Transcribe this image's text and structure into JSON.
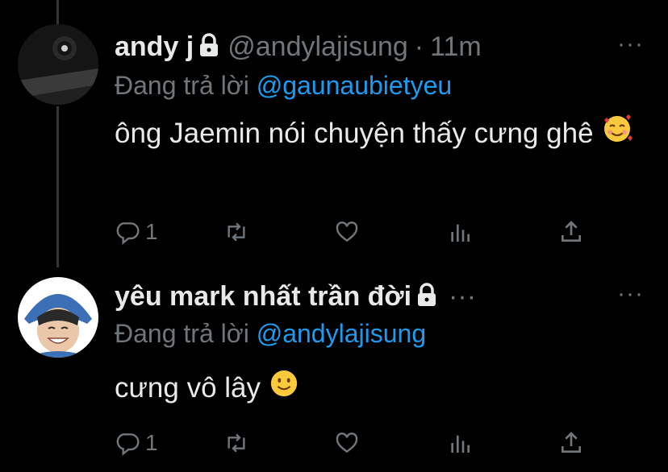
{
  "tweets": [
    {
      "name": "andy j",
      "handle": "@andylajisung",
      "separator": "·",
      "time": "11m",
      "replying_prefix": "Đang trả lời",
      "replying_to": "@gaunaubietyeu",
      "text": "ông Jaemin nói chuyện thấy cưng ghê",
      "emoji": "smiling-face-with-hearts",
      "reply_count": "1",
      "more": "···"
    },
    {
      "name": "yêu mark nhất trần đời",
      "handle": "",
      "separator": "···",
      "time": "",
      "replying_prefix": "Đang trả lời",
      "replying_to": "@andylajisung",
      "text": "cưng vô lây",
      "emoji": "slightly-smiling-face",
      "reply_count": "1",
      "more": "···"
    }
  ],
  "colors": {
    "background": "#000000",
    "text": "#e7e9ea",
    "secondary": "#71767b",
    "accent": "#1d9bf0"
  },
  "icons": [
    "reply-icon",
    "retweet-icon",
    "like-icon",
    "views-icon",
    "share-icon",
    "lock-icon"
  ]
}
